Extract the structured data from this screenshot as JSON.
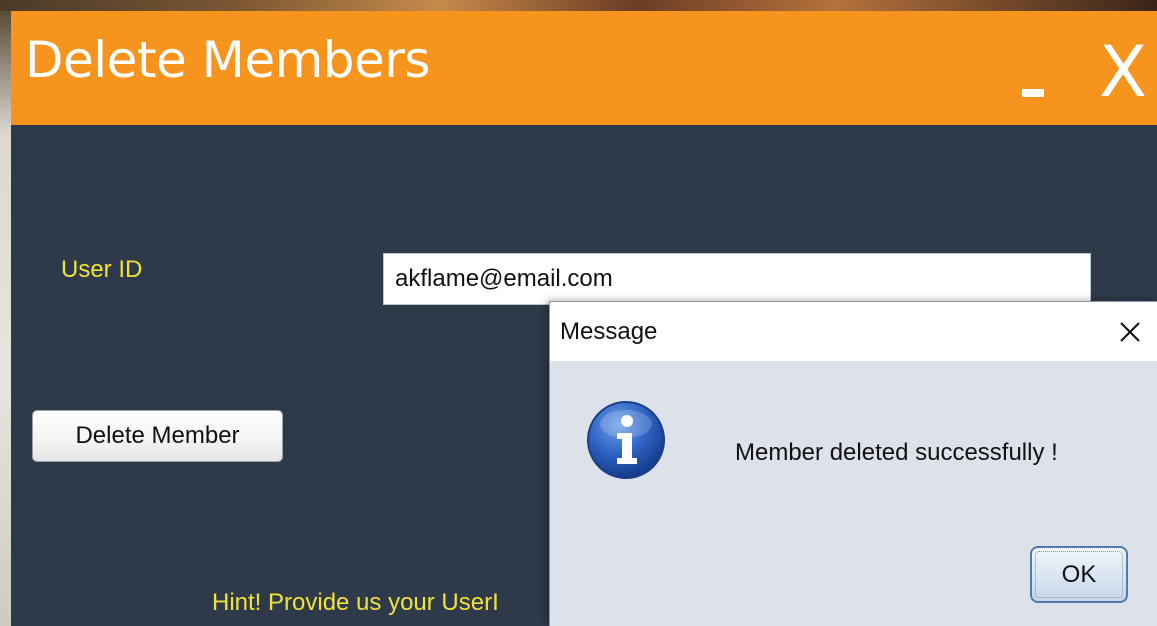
{
  "window": {
    "title": "Delete Members",
    "minimize_label": "-",
    "close_label": "X",
    "accent_color": "#f7941d",
    "background_color": "#2e3a4a"
  },
  "form": {
    "user_id_label": "User ID",
    "user_id_value": "akflame@email.com",
    "delete_button_label": "Delete Member",
    "hint_text": "Hint! Provide us your UserI"
  },
  "dialog": {
    "title": "Message",
    "icon": "info-icon",
    "message": "Member deleted successfully !",
    "ok_label": "OK"
  }
}
